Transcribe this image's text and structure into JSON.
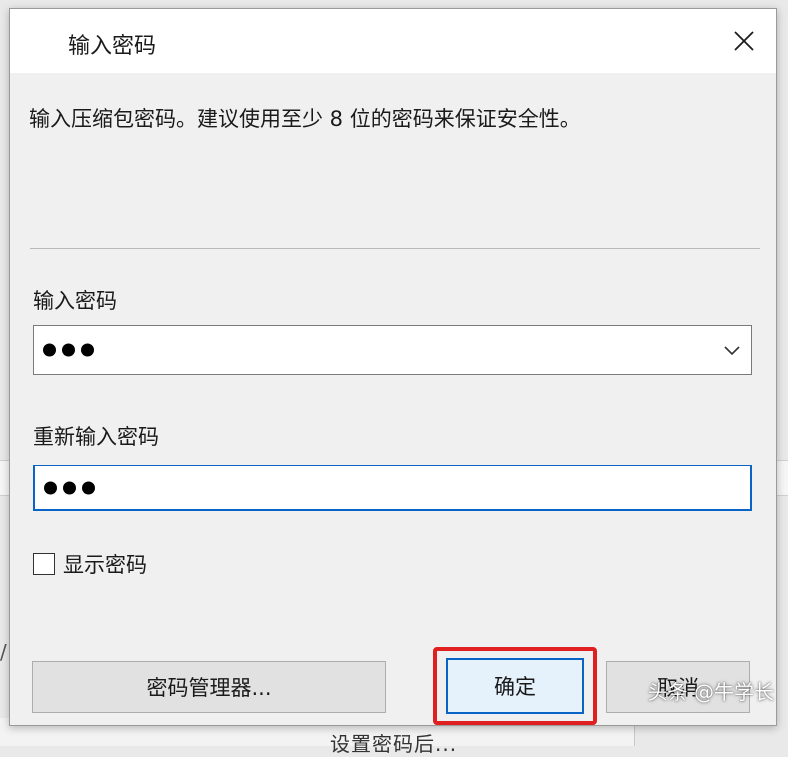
{
  "dialog": {
    "title": "输入密码",
    "description": "输入压缩包密码。建议使用至少 8 位的密码来保证安全性。",
    "password_label": "输入密码",
    "password_value": "•••",
    "confirm_label": "重新输入密码",
    "confirm_value": "•••",
    "show_password_label": "显示密码",
    "show_password_checked": false,
    "buttons": {
      "manager": "密码管理器...",
      "ok": "确定",
      "cancel": "取消"
    }
  },
  "background": {
    "edge_text": "/",
    "bottom_text": "设置密码后..."
  },
  "watermark": "头条 @牛学长",
  "icons": {
    "close": "close-icon",
    "dropdown": "chevron-down-icon",
    "checkbox": "checkbox-icon"
  },
  "colors": {
    "focus_border": "#0a64c8",
    "highlight": "#e02020",
    "dialog_bg": "#f0f0f0",
    "title_bg": "#ffffff"
  }
}
